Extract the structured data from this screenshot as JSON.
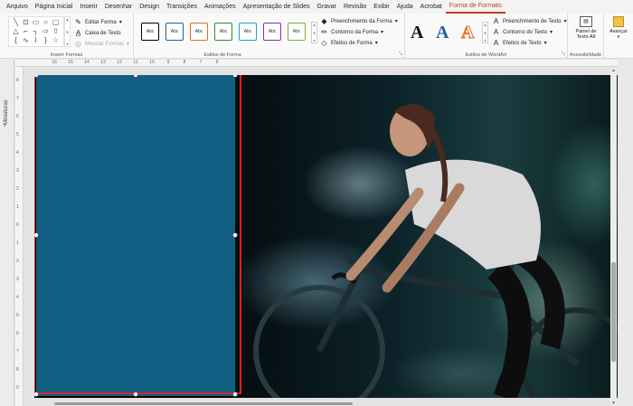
{
  "menu": {
    "tabs": [
      "Arquivo",
      "Página Inicial",
      "Inserir",
      "Desenhar",
      "Design",
      "Transições",
      "Animações",
      "Apresentação de Slides",
      "Gravar",
      "Revisão",
      "Exibir",
      "Ajuda",
      "Acrobat",
      "Forma de Formato"
    ],
    "active_tab": "Forma de Formato"
  },
  "ribbon": {
    "insert_shapes": {
      "label": "Inserir Formas",
      "edit_shape": "Editar Forma",
      "text_box": "Caixa de Texto",
      "merge_shapes": "Mesclar Formas"
    },
    "shape_styles": {
      "label": "Estilos de Forma",
      "style_samples": [
        "Abc",
        "Abc",
        "Abc",
        "Abc",
        "Abc",
        "Abc",
        "Abc"
      ],
      "style_colors": [
        "#000000",
        "#1f5fa0",
        "#e06c2a",
        "#2f8a3a",
        "#20a0c0",
        "#8a2fa0",
        "#7ab03a"
      ],
      "fill": "Preenchimento da Forma",
      "outline": "Contorno da Forma",
      "effects": "Efeitos de Forma"
    },
    "wordart": {
      "label": "Estilos de WordArt",
      "samples": [
        "A",
        "A",
        "A"
      ],
      "text_fill": "Preenchimento de Texto",
      "text_outline": "Contorno do Texto",
      "text_effects": "Efeitos de Texto"
    },
    "accessibility": {
      "label": "Acessibilidade",
      "alt_text_line1": "Painel de",
      "alt_text_line2": "Texto Alt"
    },
    "arrange": {
      "bring_forward": "Avançar"
    }
  },
  "thumbnail_pane": {
    "label": "Miniaturas"
  },
  "ruler": {
    "h_ticks": [
      "16",
      "15",
      "14",
      "13",
      "12",
      "11",
      "10",
      "9",
      "8",
      "7",
      "6"
    ],
    "v_ticks": [
      "8",
      "7",
      "6",
      "5",
      "4",
      "3",
      "2",
      "1",
      "0",
      "1",
      "2",
      "3",
      "4",
      "5",
      "6",
      "7",
      "8",
      "9"
    ]
  },
  "slide": {
    "rectangle_color": "#125e82",
    "selection_color": "#e02020"
  }
}
